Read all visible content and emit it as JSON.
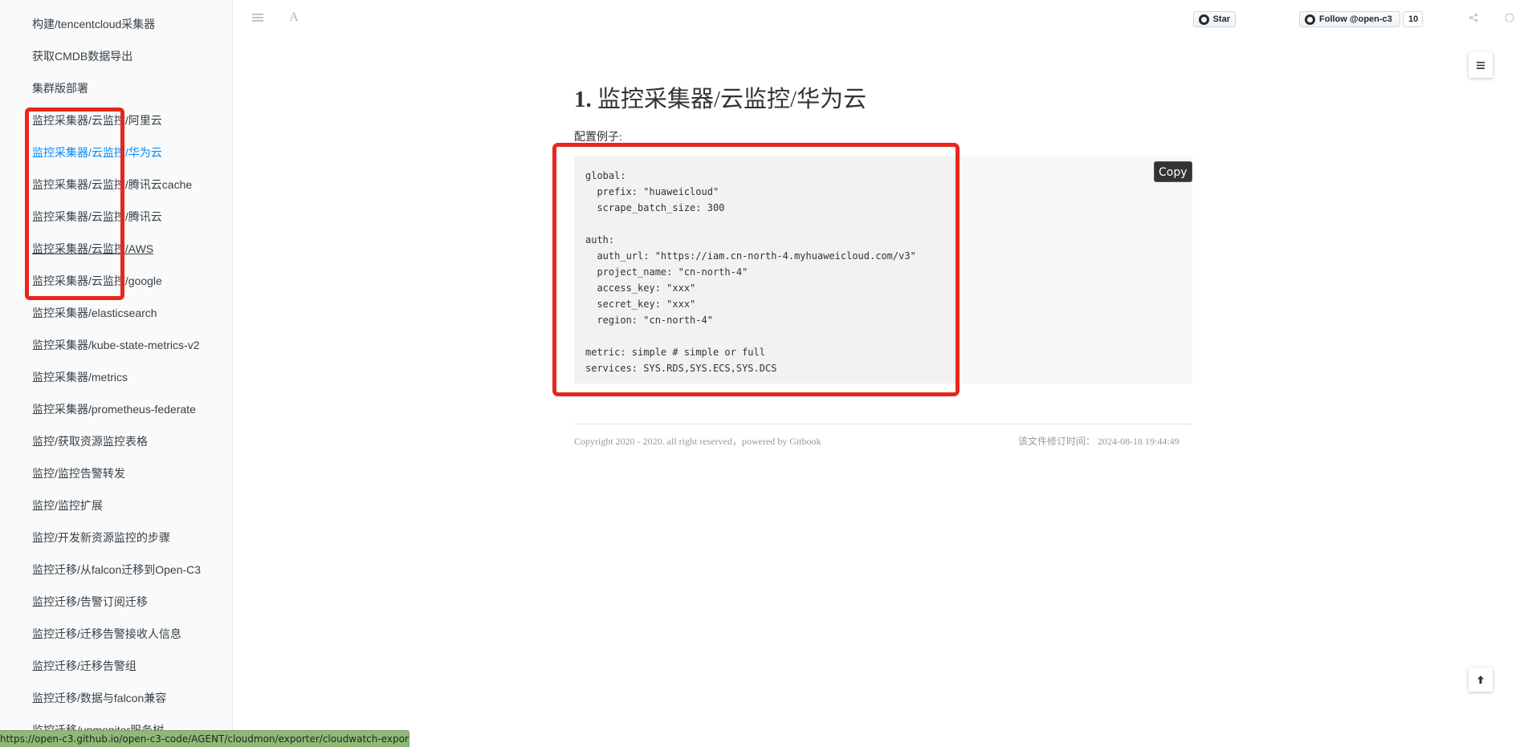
{
  "sidebar": {
    "items": [
      {
        "label": "构建/tencentcloud采集器"
      },
      {
        "label": "获取CMDB数据导出"
      },
      {
        "label": "集群版部署"
      },
      {
        "label": "监控采集器/云监控/阿里云"
      },
      {
        "label": "监控采集器/云监控/华为云",
        "active": true
      },
      {
        "label": "监控采集器/云监控/腾讯云cache"
      },
      {
        "label": "监控采集器/云监控/腾讯云"
      },
      {
        "label": "监控采集器/云监控/AWS",
        "hover": true
      },
      {
        "label": "监控采集器/云监控/google"
      },
      {
        "label": "监控采集器/elasticsearch"
      },
      {
        "label": "监控采集器/kube-state-metrics-v2"
      },
      {
        "label": "监控采集器/metrics"
      },
      {
        "label": "监控采集器/prometheus-federate"
      },
      {
        "label": "监控/获取资源监控表格"
      },
      {
        "label": "监控/监控告警转发"
      },
      {
        "label": "监控/监控扩展"
      },
      {
        "label": "监控/开发新资源监控的步骤"
      },
      {
        "label": "监控迁移/从falcon迁移到Open-C3"
      },
      {
        "label": "监控迁移/告警订阅迁移"
      },
      {
        "label": "监控迁移/迁移告警接收人信息"
      },
      {
        "label": "监控迁移/迁移告警组"
      },
      {
        "label": "监控迁移/数据与falcon兼容"
      },
      {
        "label": "监控迁移/upmonitor服务树"
      }
    ]
  },
  "header": {
    "menu_icon": "menu-icon",
    "font_icon": "font-settings-icon",
    "font_glyph": "A",
    "star_label": "Star",
    "follow_label": "Follow @open-c3",
    "follow_count": "10",
    "share_icon": "share-icon",
    "github_icon": "github-icon"
  },
  "main": {
    "title_number": "1.",
    "title_text": "监控采集器/云监控/华为云",
    "config_label": "配置例子:",
    "code": "global:\n  prefix: \"huaweicloud\"\n  scrape_batch_size: 300\n\nauth:\n  auth_url: \"https://iam.cn-north-4.myhuaweicloud.com/v3\"\n  project_name: \"cn-north-4\"\n  access_key: \"xxx\"\n  secret_key: \"xxx\"\n  region: \"cn-north-4\"\n\nmetric: simple # simple or full\nservices: SYS.RDS,SYS.ECS,SYS.DCS",
    "copy_label": "Copy"
  },
  "footer": {
    "copyright": "Copyright 2020 - 2020. all right reserved，powered by Gitbook",
    "modified": "该文件修订时间： 2024-08-18 19:44:49"
  },
  "status_url": "https://open-c3.github.io/open-c3-code/AGENT/cloudmon/exporter/cloudwatch-exporter/",
  "colors": {
    "annotation": "#e8261c",
    "active_link": "#008cff",
    "status_bar": "#8fb87a"
  }
}
